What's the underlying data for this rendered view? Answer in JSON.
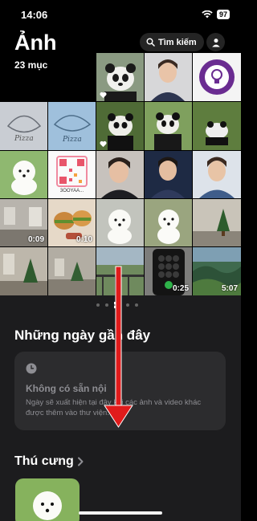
{
  "status": {
    "time": "14:06",
    "battery": "97"
  },
  "header": {
    "title": "Ảnh",
    "count": "23 mục",
    "search_label": "Tìm kiếm"
  },
  "grid": {
    "tiles": [
      {
        "kind": "video",
        "duration": "0:09"
      },
      {
        "kind": "video",
        "duration": "0:10"
      },
      {
        "kind": "video",
        "duration": "0:25"
      },
      {
        "kind": "video",
        "duration": "5:07"
      }
    ],
    "qr_caption": "3OOYAA..."
  },
  "recent": {
    "title": "Những ngày gần đây",
    "card_title": "Không có sẵn nội",
    "card_desc": "Ngày sẽ xuất hiện tại đây khi các ảnh và video khác được thêm vào thư viện."
  },
  "pets": {
    "title": "Thú cưng"
  },
  "colors": {
    "background": "#000000",
    "section_bg": "#1c1c1e",
    "card_bg": "#2c2c2e",
    "arrow": "#e01b1b"
  }
}
